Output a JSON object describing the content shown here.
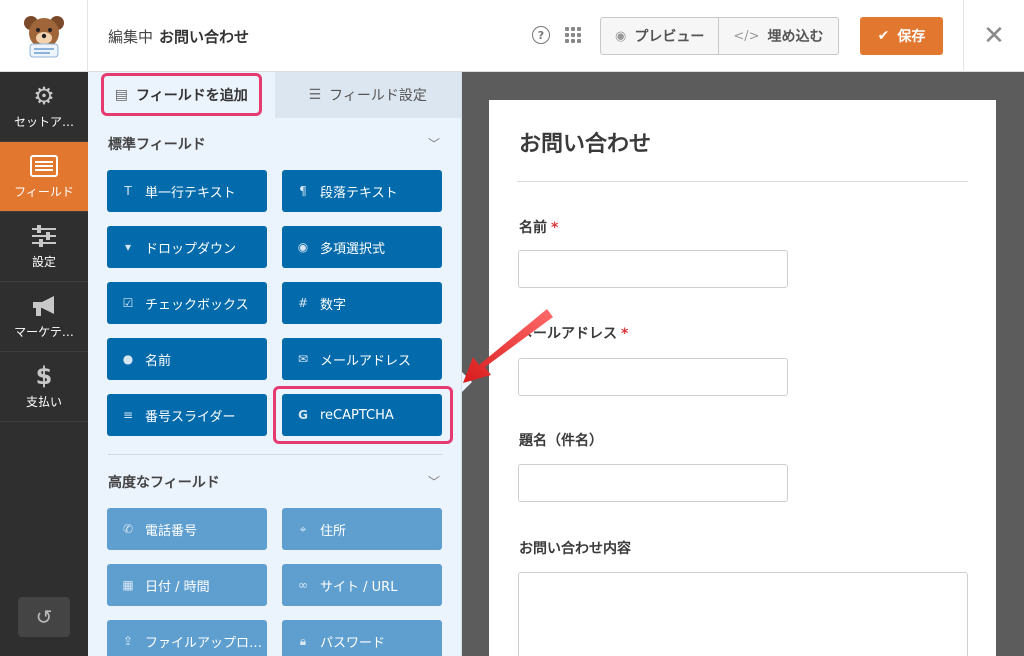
{
  "topbar": {
    "editing_label": "編集中",
    "form_name": "お問い合わせ",
    "preview_label": "プレビュー",
    "embed_label": "埋め込む",
    "save_label": "保存",
    "colors": {
      "save": "#e27730"
    }
  },
  "nav": {
    "items": [
      {
        "label": "セットア…",
        "icon": "gear-icon"
      },
      {
        "label": "フィールド",
        "icon": "fields-icon",
        "active": true
      },
      {
        "label": "設定",
        "icon": "sliders-icon"
      },
      {
        "label": "マーケテ…",
        "icon": "megaphone-icon"
      },
      {
        "label": "支払い",
        "icon": "dollar-icon"
      }
    ]
  },
  "panel": {
    "tabs": [
      {
        "label": "フィールドを追加",
        "active": true
      },
      {
        "label": "フィールド設定",
        "active": false
      }
    ],
    "standard": {
      "title": "標準フィールド",
      "fields": [
        {
          "label": "単一行テキスト",
          "icon": "text-icon"
        },
        {
          "label": "段落テキスト",
          "icon": "paragraph-icon"
        },
        {
          "label": "ドロップダウン",
          "icon": "dropdown-icon"
        },
        {
          "label": "多項選択式",
          "icon": "radio-icon"
        },
        {
          "label": "チェックボックス",
          "icon": "checkbox-icon"
        },
        {
          "label": "数字",
          "icon": "hash-icon"
        },
        {
          "label": "名前",
          "icon": "user-icon"
        },
        {
          "label": "メールアドレス",
          "icon": "envelope-icon"
        },
        {
          "label": "番号スライダー",
          "icon": "slider-icon"
        },
        {
          "label": "reCAPTCHA",
          "icon": "google-icon"
        }
      ]
    },
    "advanced": {
      "title": "高度なフィールド",
      "fields": [
        {
          "label": "電話番号",
          "icon": "phone-icon"
        },
        {
          "label": "住所",
          "icon": "map-pin-icon"
        },
        {
          "label": "日付 / 時間",
          "icon": "calendar-icon"
        },
        {
          "label": "サイト / URL",
          "icon": "link-icon"
        },
        {
          "label": "ファイルアップロ…",
          "icon": "upload-icon"
        },
        {
          "label": "パスワード",
          "icon": "lock-icon"
        }
      ]
    }
  },
  "form": {
    "title": "お問い合わせ",
    "fields": [
      {
        "label": "名前",
        "required": "*"
      },
      {
        "label": "メールアドレス",
        "required": "*"
      },
      {
        "label": "題名（件名）"
      },
      {
        "label": "お問い合わせ内容"
      }
    ]
  }
}
